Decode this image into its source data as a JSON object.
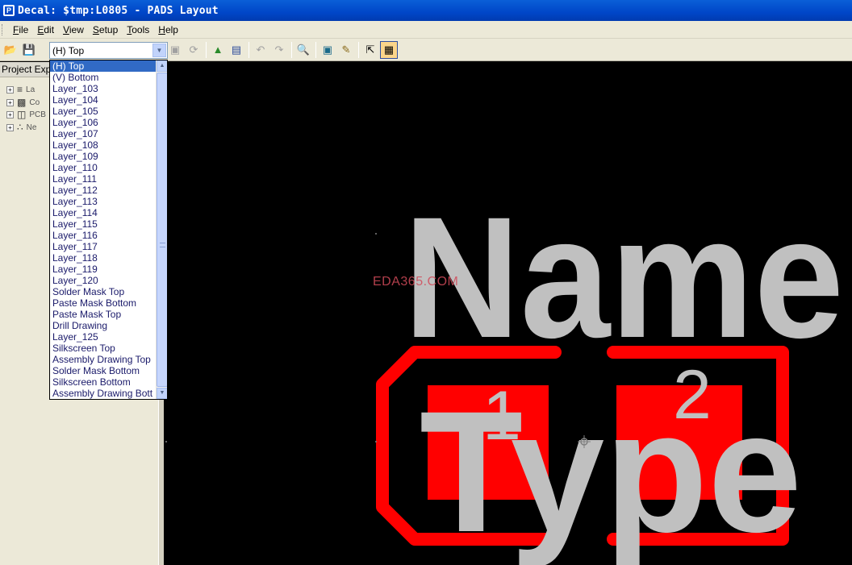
{
  "window": {
    "title": "Decal: $tmp:L0805 - PADS Layout"
  },
  "menu": [
    {
      "key": "F",
      "rest": "ile"
    },
    {
      "key": "E",
      "rest": "dit"
    },
    {
      "key": "V",
      "rest": "iew"
    },
    {
      "key": "S",
      "rest": "etup"
    },
    {
      "key": "T",
      "rest": "ools"
    },
    {
      "key": "H",
      "rest": "elp"
    }
  ],
  "layer_select": {
    "value": "(H) Top"
  },
  "layer_options": [
    "(H) Top",
    "(V) Bottom",
    "Layer_103",
    "Layer_104",
    "Layer_105",
    "Layer_106",
    "Layer_107",
    "Layer_108",
    "Layer_109",
    "Layer_110",
    "Layer_111",
    "Layer_112",
    "Layer_113",
    "Layer_114",
    "Layer_115",
    "Layer_116",
    "Layer_117",
    "Layer_118",
    "Layer_119",
    "Layer_120",
    "Solder Mask Top",
    "Paste Mask Bottom",
    "Paste Mask Top",
    "Drill Drawing",
    "Layer_125",
    "Silkscreen Top",
    "Assembly Drawing Top",
    "Solder Mask Bottom",
    "Silkscreen Bottom",
    "Assembly Drawing Bott"
  ],
  "project_explorer": {
    "header": "Project Exp",
    "items": [
      "La",
      "Co",
      "PCB",
      "Ne"
    ]
  },
  "canvas": {
    "name_text": "Name",
    "type_text": "Type",
    "pad1_label": "1",
    "pad2_label": "2",
    "watermark": "EDA365.COM"
  },
  "colors": {
    "silkscreen": "#c0c0c0",
    "pads": "#ff0000",
    "background": "#000000",
    "selection": "#316ac5"
  }
}
